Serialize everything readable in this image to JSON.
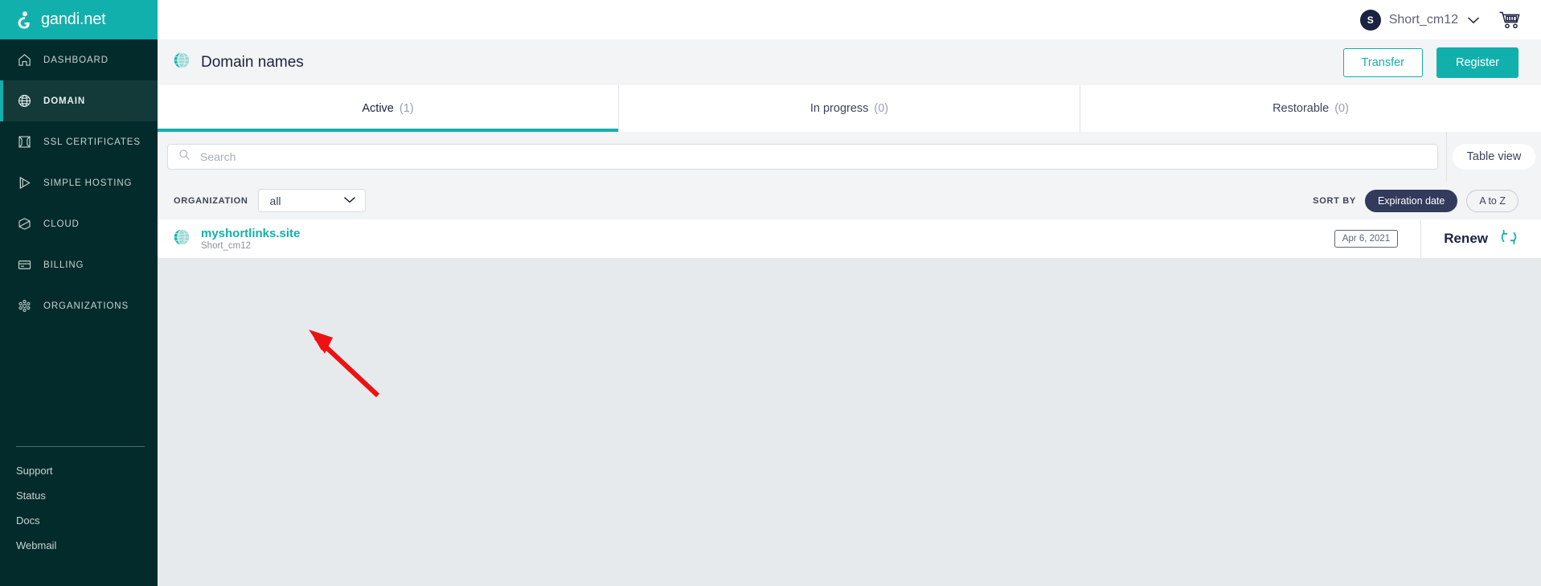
{
  "brand": {
    "name": "gandi.net",
    "icon": "gandi-logo-icon",
    "bg_color": "#12b0ad"
  },
  "sidebar": {
    "bg_color": "#042b2b",
    "items": [
      {
        "label": "DASHBOARD",
        "icon": "home-icon",
        "active": false
      },
      {
        "label": "DOMAIN",
        "icon": "globe-icon",
        "active": true
      },
      {
        "label": "SSL CERTIFICATES",
        "icon": "certificate-icon",
        "active": false
      },
      {
        "label": "SIMPLE HOSTING",
        "icon": "play-triangle-icon",
        "active": false
      },
      {
        "label": "CLOUD",
        "icon": "cube-icon",
        "active": false
      },
      {
        "label": "BILLING",
        "icon": "credit-card-icon",
        "active": false
      },
      {
        "label": "ORGANIZATIONS",
        "icon": "organizations-icon",
        "active": false
      }
    ],
    "footer_links": [
      "Support",
      "Status",
      "Docs",
      "Webmail"
    ]
  },
  "topbar": {
    "avatar_initial": "S",
    "user_name": "Short_cm12",
    "chevron_icon": "chevron-down-icon",
    "cart_icon": "shopping-cart-icon"
  },
  "card": {
    "icon": "globe-icon",
    "title": "Domain names",
    "transfer_label": "Transfer",
    "register_label": "Register",
    "accent_color": "#12b0ad"
  },
  "tabs": [
    {
      "label": "Active",
      "count": "(1)",
      "active": true
    },
    {
      "label": "In progress",
      "count": "(0)",
      "active": false
    },
    {
      "label": "Restorable",
      "count": "(0)",
      "active": false
    }
  ],
  "search": {
    "placeholder": "Search",
    "value": "",
    "icon": "search-icon",
    "table_view_label": "Table view"
  },
  "filters": {
    "organization_caption": "ORGANIZATION",
    "organization_value": "all",
    "organization_chevron": "chevron-down-icon",
    "sort_caption": "SORT BY",
    "sort_options": [
      {
        "label": "Expiration date",
        "active": true
      },
      {
        "label": "A to Z",
        "active": false
      }
    ]
  },
  "domains": [
    {
      "icon": "globe-icon",
      "name": "myshortlinks.site",
      "organization": "Short_cm12",
      "expiration_date": "Apr 6, 2021",
      "renew_label": "Renew",
      "renew_icon": "refresh-cycle-icon"
    }
  ],
  "annotation": {
    "type": "arrow",
    "color": "#ee1111",
    "points_to": "myshortlinks.site"
  }
}
